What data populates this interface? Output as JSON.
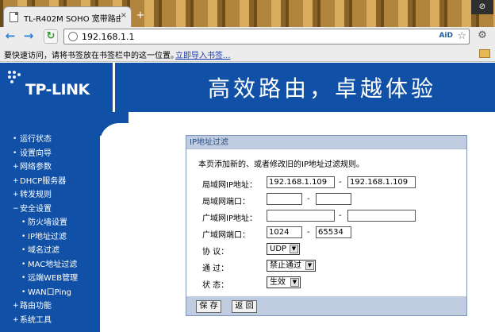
{
  "browser": {
    "tab_title": "TL-R402M SOHO 宽带路由器",
    "tab_close": "×",
    "new_tab": "+",
    "window_button": "⊘",
    "url": "192.168.1.1",
    "aid_label": "AiD",
    "bookmark_hint": "要快速访问，请将书签放在书签栏中的这一位置。",
    "bookmark_import_link": "立即导入书签..."
  },
  "header": {
    "logo": "TP-LINK",
    "slogan": "高效路由，卓越体验"
  },
  "sidebar": {
    "items": [
      {
        "label": "运行状态",
        "bullet": "•"
      },
      {
        "label": "设置向导",
        "bullet": "•"
      },
      {
        "label": "网络参数",
        "bullet": "+"
      },
      {
        "label": "DHCP服务器",
        "bullet": "+"
      },
      {
        "label": "转发规则",
        "bullet": "+"
      },
      {
        "label": "安全设置",
        "bullet": "−"
      },
      {
        "label": "防火墙设置",
        "bullet": "•"
      },
      {
        "label": "IP地址过滤",
        "bullet": "•"
      },
      {
        "label": "域名过滤",
        "bullet": "•"
      },
      {
        "label": "MAC地址过滤",
        "bullet": "•"
      },
      {
        "label": "远端WEB管理",
        "bullet": "•"
      },
      {
        "label": "WAN口Ping",
        "bullet": "•"
      },
      {
        "label": "路由功能",
        "bullet": "+"
      },
      {
        "label": "系统工具",
        "bullet": "+"
      }
    ]
  },
  "panel": {
    "title": "IP地址过滤",
    "description": "本页添加新的、或者修改旧的IP地址过滤规则。",
    "dash": "-",
    "lan_ip_label": "局域网IP地址：",
    "lan_ip_start": "192.168.1.109",
    "lan_ip_end": "192.168.1.109",
    "lan_port_label": "局域网端口：",
    "lan_port_start": "",
    "lan_port_end": "",
    "wan_ip_label": "广域网IP地址：",
    "wan_ip_start": "",
    "wan_ip_end": "",
    "wan_port_label": "广域网端口：",
    "wan_port_start": "1024",
    "wan_port_end": "65534",
    "protocol_label": "协  议：",
    "protocol_value": "UDP",
    "pass_label": "通  过：",
    "pass_value": "禁止通过",
    "status_label": "状  态：",
    "status_value": "生效",
    "save_button": "保 存",
    "back_button": "返 回"
  }
}
